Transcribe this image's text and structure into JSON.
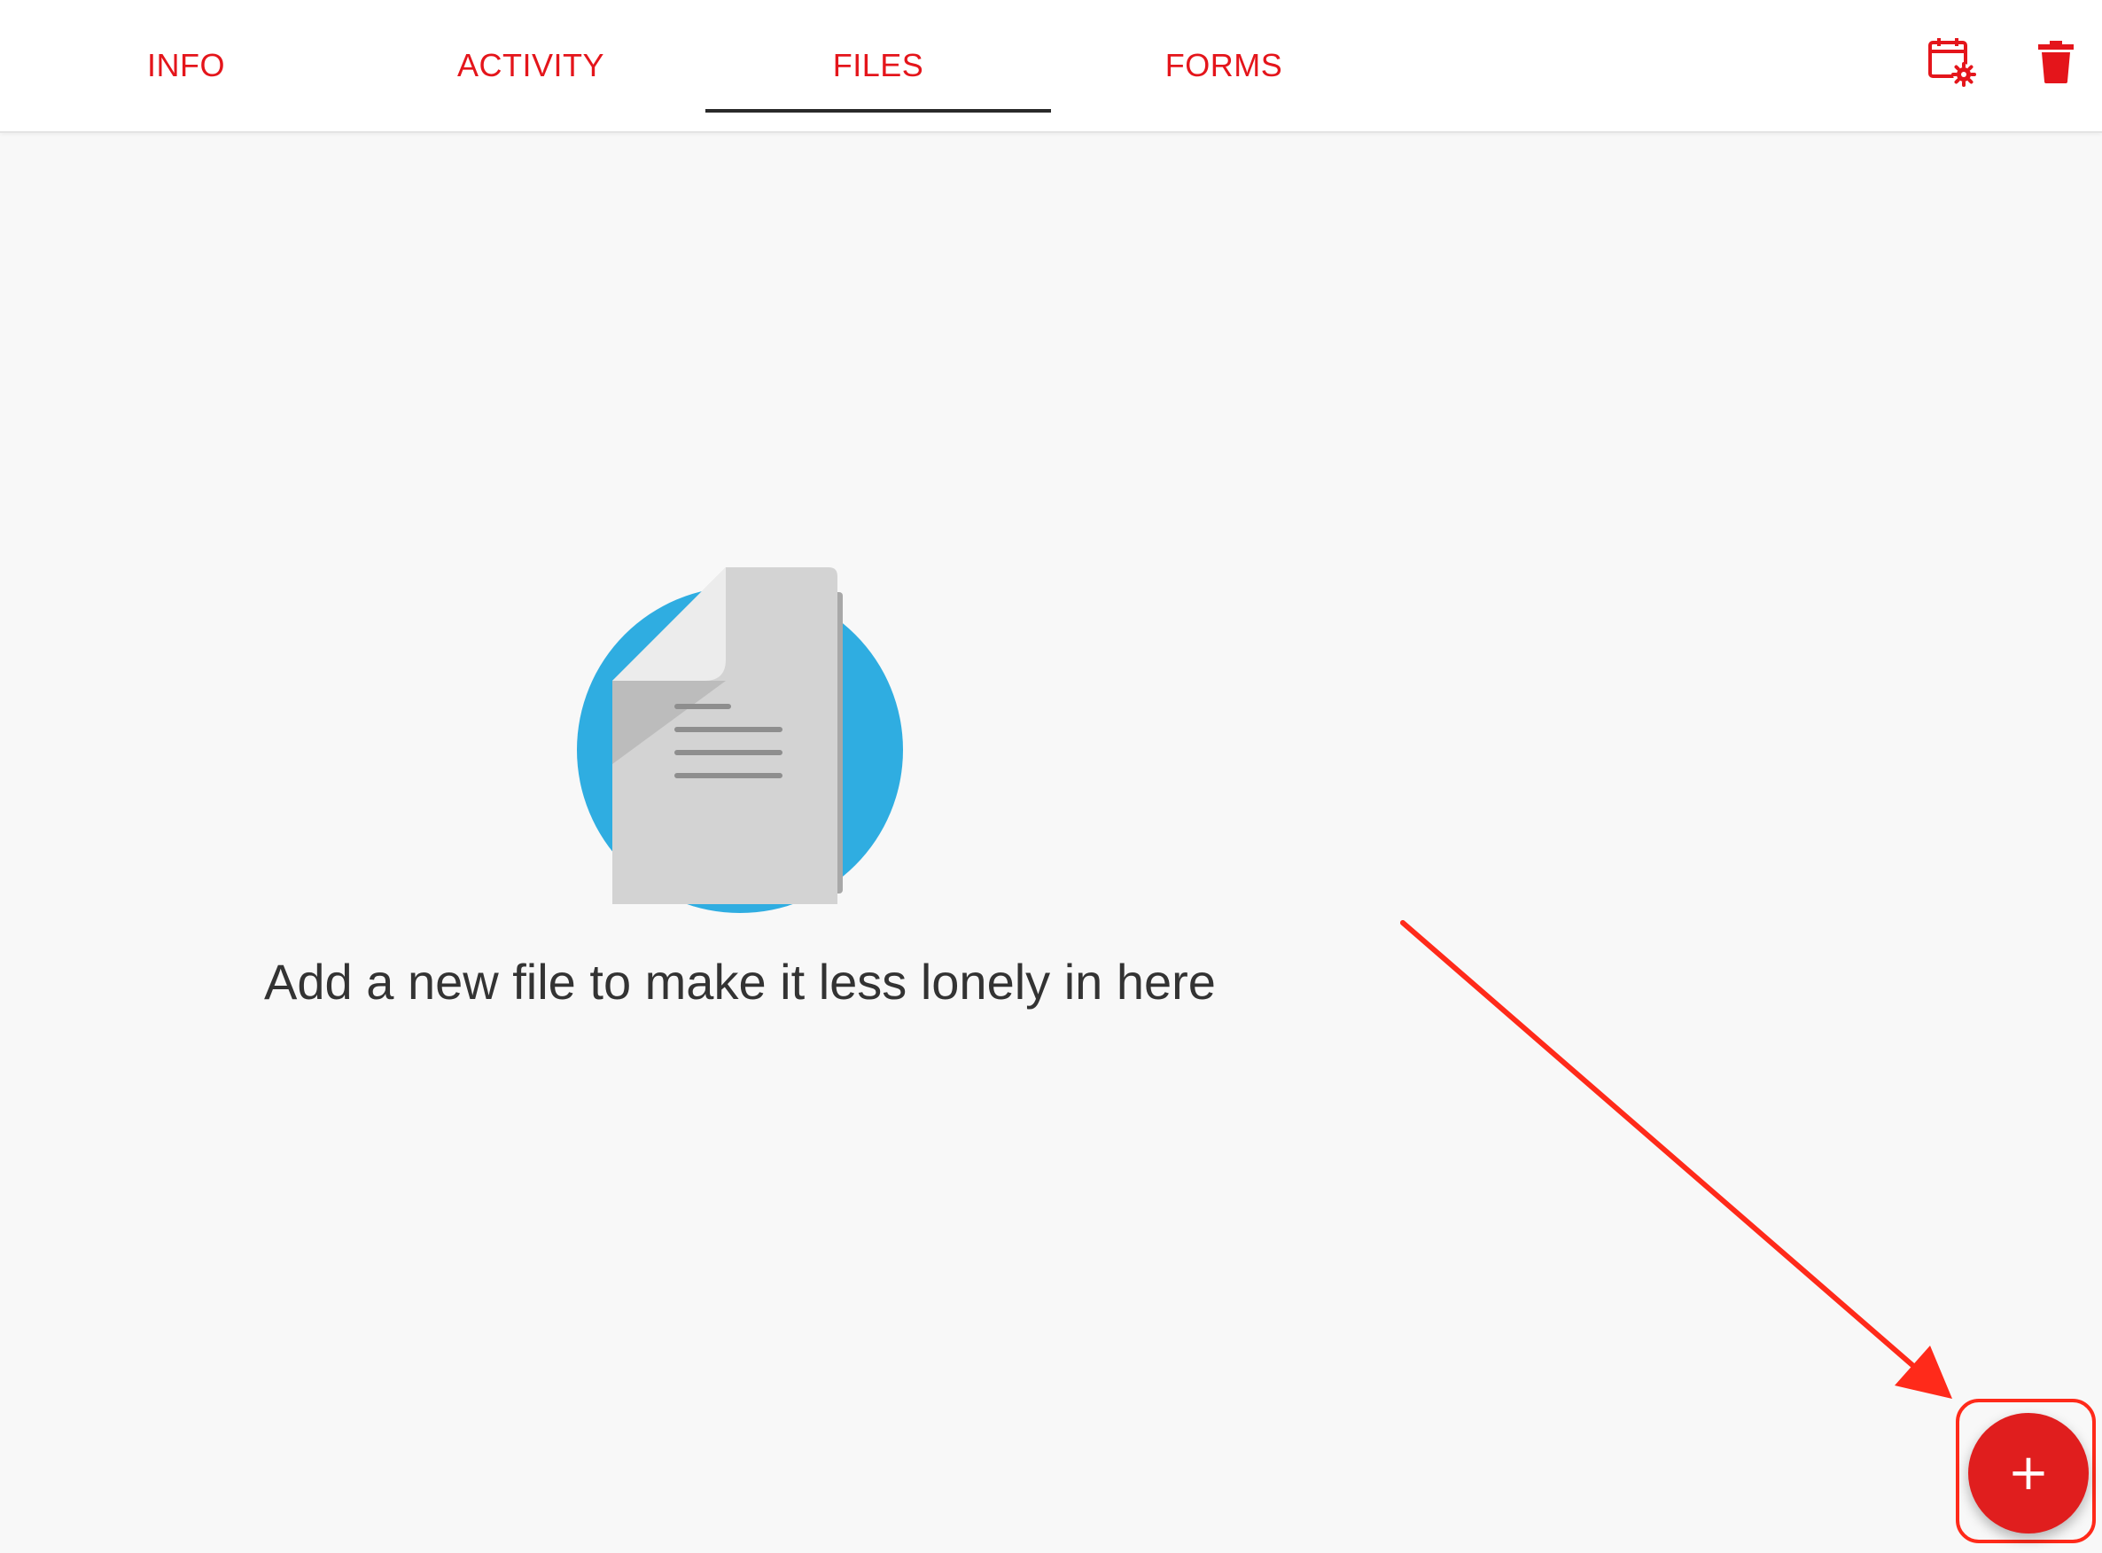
{
  "tabs": [
    {
      "id": "info",
      "label": "INFO",
      "active": false
    },
    {
      "id": "activity",
      "label": "ACTIVITY",
      "active": false
    },
    {
      "id": "files",
      "label": "FILES",
      "active": true
    },
    {
      "id": "forms",
      "label": "FORMS",
      "active": false
    }
  ],
  "toolbar": {
    "schedule_icon": "calendar-settings-icon",
    "delete_icon": "trash-icon"
  },
  "empty_state": {
    "illustration": "document-icon",
    "message": "Add a new file to make it less lonely in here"
  },
  "fab": {
    "icon": "plus-icon",
    "label": "+"
  },
  "annotation": {
    "type": "arrow-pointing-to-add-button",
    "color": "#ff2a1a"
  },
  "colors": {
    "accent": "#e4151b",
    "fab": "#e01e1e",
    "illustration_circle": "#2fade1",
    "background": "#f8f8f8"
  }
}
